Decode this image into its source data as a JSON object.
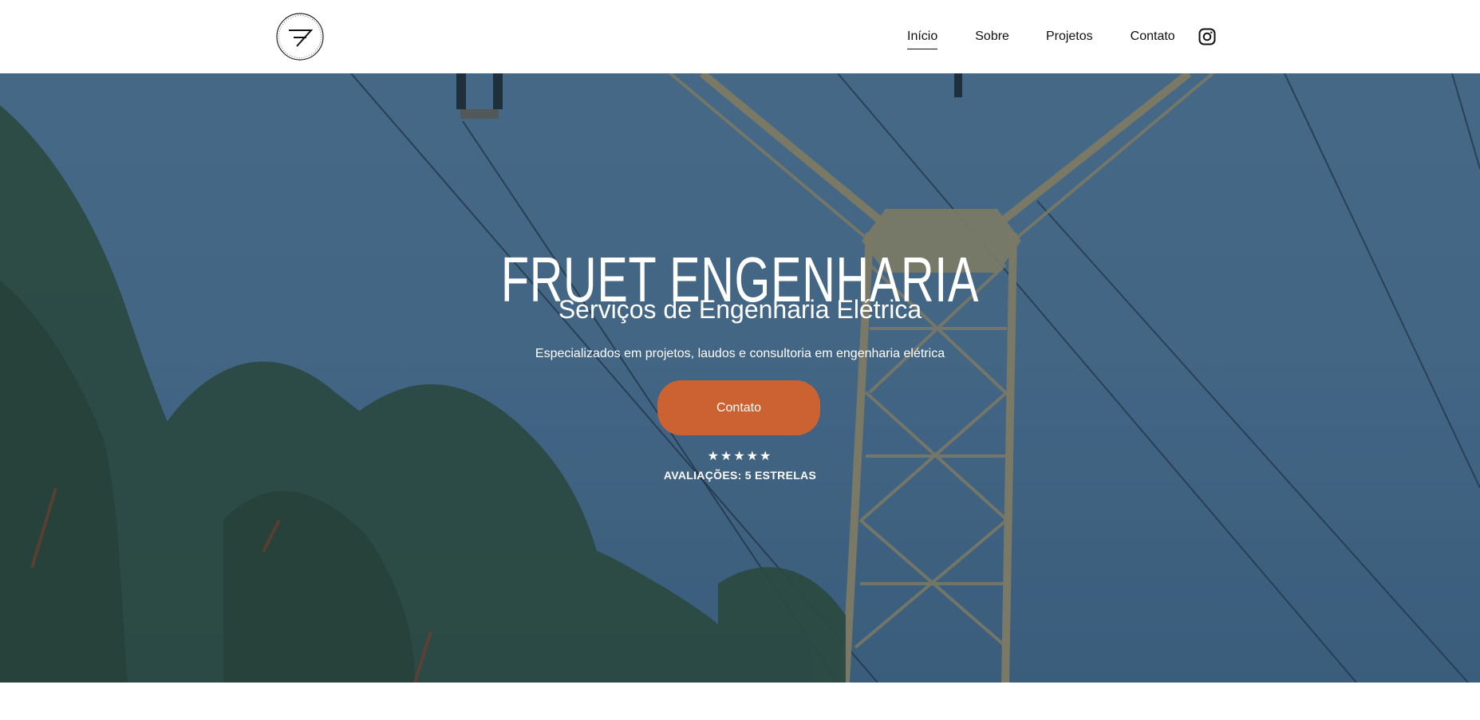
{
  "header": {
    "logo_alt": "Fruet Engenharia logo",
    "nav": [
      {
        "label": "Início",
        "active": true
      },
      {
        "label": "Sobre"
      },
      {
        "label": "Projetos"
      },
      {
        "label": "Contato"
      }
    ],
    "social_icon": "instagram-icon"
  },
  "hero": {
    "title": "FRUET ENGENHARIA",
    "subtitle": "Serviços de Engenharia Elétrica",
    "description": "Especializados em projetos, laudos e consultoria em engenharia elétrica",
    "cta_label": "Contato",
    "stars": "★★★★★",
    "rating_label": "AVALIAÇÕES: 5 ESTRELAS"
  },
  "colors": {
    "accent": "#cc6231",
    "hero_blue": "#4a6d8d"
  }
}
